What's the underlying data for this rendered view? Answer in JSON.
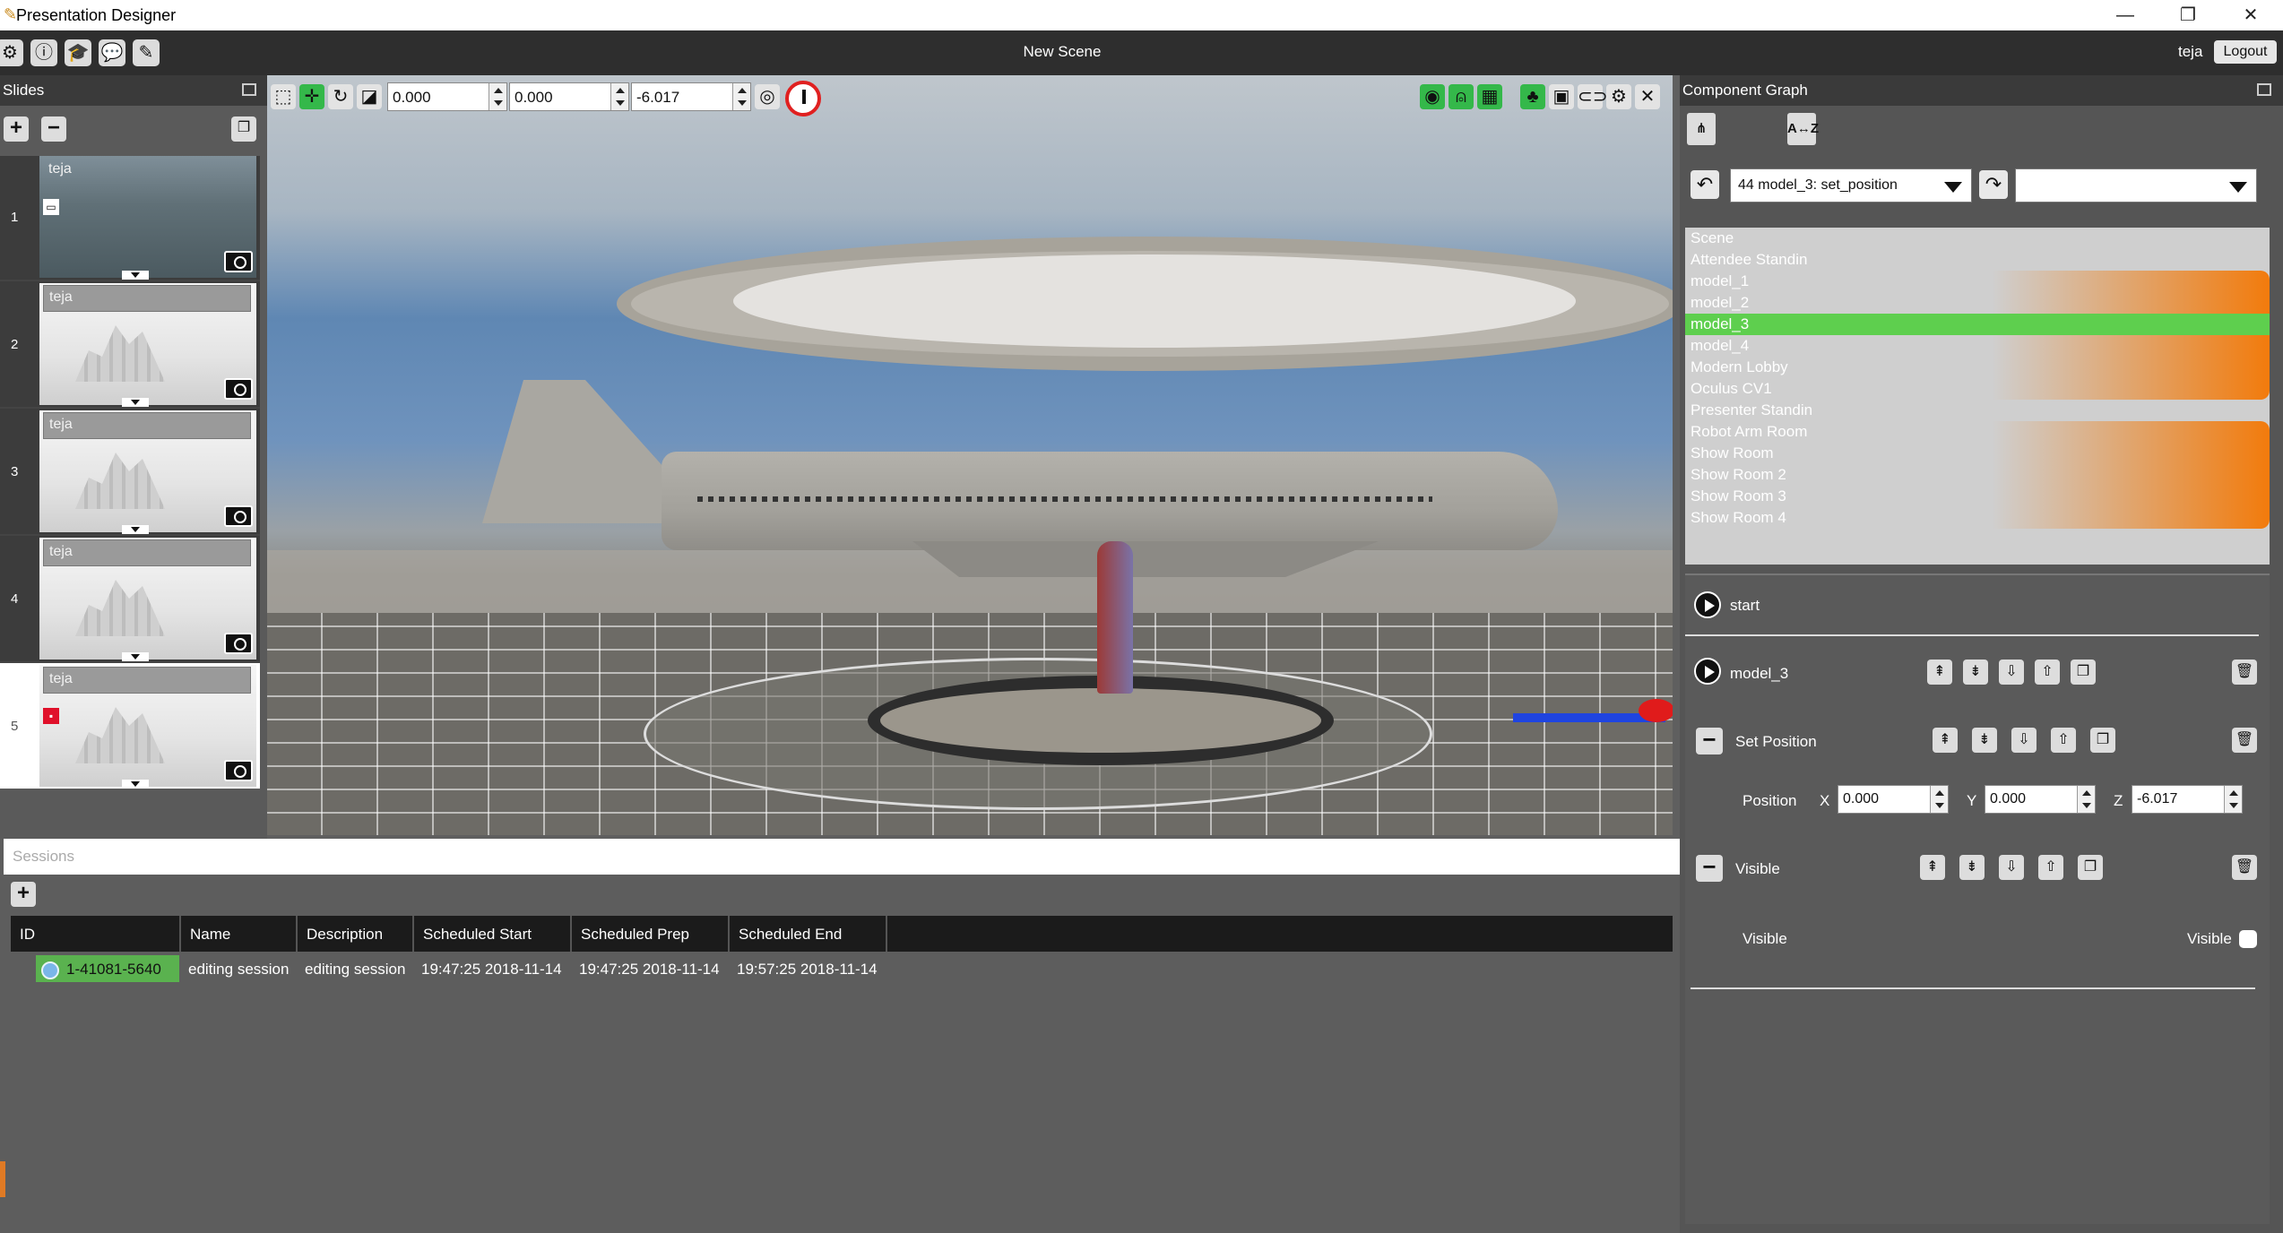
{
  "window": {
    "title": "Presentation Designer",
    "minimize": "—",
    "restore": "❐",
    "close": "✕"
  },
  "appbar": {
    "tools": [
      {
        "name": "settings-icon",
        "glyph": "⚙"
      },
      {
        "name": "info-icon",
        "glyph": "ⓘ"
      },
      {
        "name": "graduation-icon",
        "glyph": "🎓"
      },
      {
        "name": "chat-icon",
        "glyph": "💬"
      },
      {
        "name": "edit-icon",
        "glyph": "✎"
      }
    ],
    "scene_title": "New Scene",
    "user": "teja",
    "logout": "Logout"
  },
  "slides": {
    "title": "Slides",
    "add": "+",
    "remove": "−",
    "items": [
      {
        "number": "1",
        "label": "teja"
      },
      {
        "number": "2",
        "label": "teja"
      },
      {
        "number": "3",
        "label": "teja"
      },
      {
        "number": "4",
        "label": "teja"
      },
      {
        "number": "5",
        "label": "teja"
      }
    ]
  },
  "viewport": {
    "position": {
      "x": "0.000",
      "y": "0.000",
      "z": "-6.017"
    }
  },
  "sessions": {
    "header_placeholder": "Sessions",
    "add": "+",
    "columns": [
      "ID",
      "Name",
      "Description",
      "Scheduled Start",
      "Scheduled Prep",
      "Scheduled End"
    ],
    "rows": [
      {
        "id": "1-41081-5640",
        "name": "editing session",
        "description": "editing session",
        "start": "19:47:25 2018-11-14",
        "prep": "19:47:25 2018-11-14",
        "end": "19:57:25 2018-11-14"
      }
    ]
  },
  "graph": {
    "title": "Component Graph",
    "sort_label": "A↔Z",
    "history_value": "44 model_3: set_position",
    "redo_value": "",
    "tree": [
      "Scene",
      "Attendee Standin",
      "model_1",
      "model_2",
      "model_3",
      "model_4",
      "Modern Lobby",
      "Oculus CV1",
      "Presenter Standin",
      "Robot Arm Room",
      "Show Room",
      "Show Room 2",
      "Show Room 3",
      "Show Room 4"
    ],
    "selected": "model_3",
    "start_label": "start",
    "node_label": "model_3",
    "set_position_label": "Set Position",
    "position_label": "Position",
    "x_label": "X",
    "y_label": "Y",
    "z_label": "Z",
    "x": "0.000",
    "y": "0.000",
    "z": "-6.017",
    "visible_section": "Visible",
    "visible_row_label": "Visible",
    "visible_check_label": "Visible"
  }
}
